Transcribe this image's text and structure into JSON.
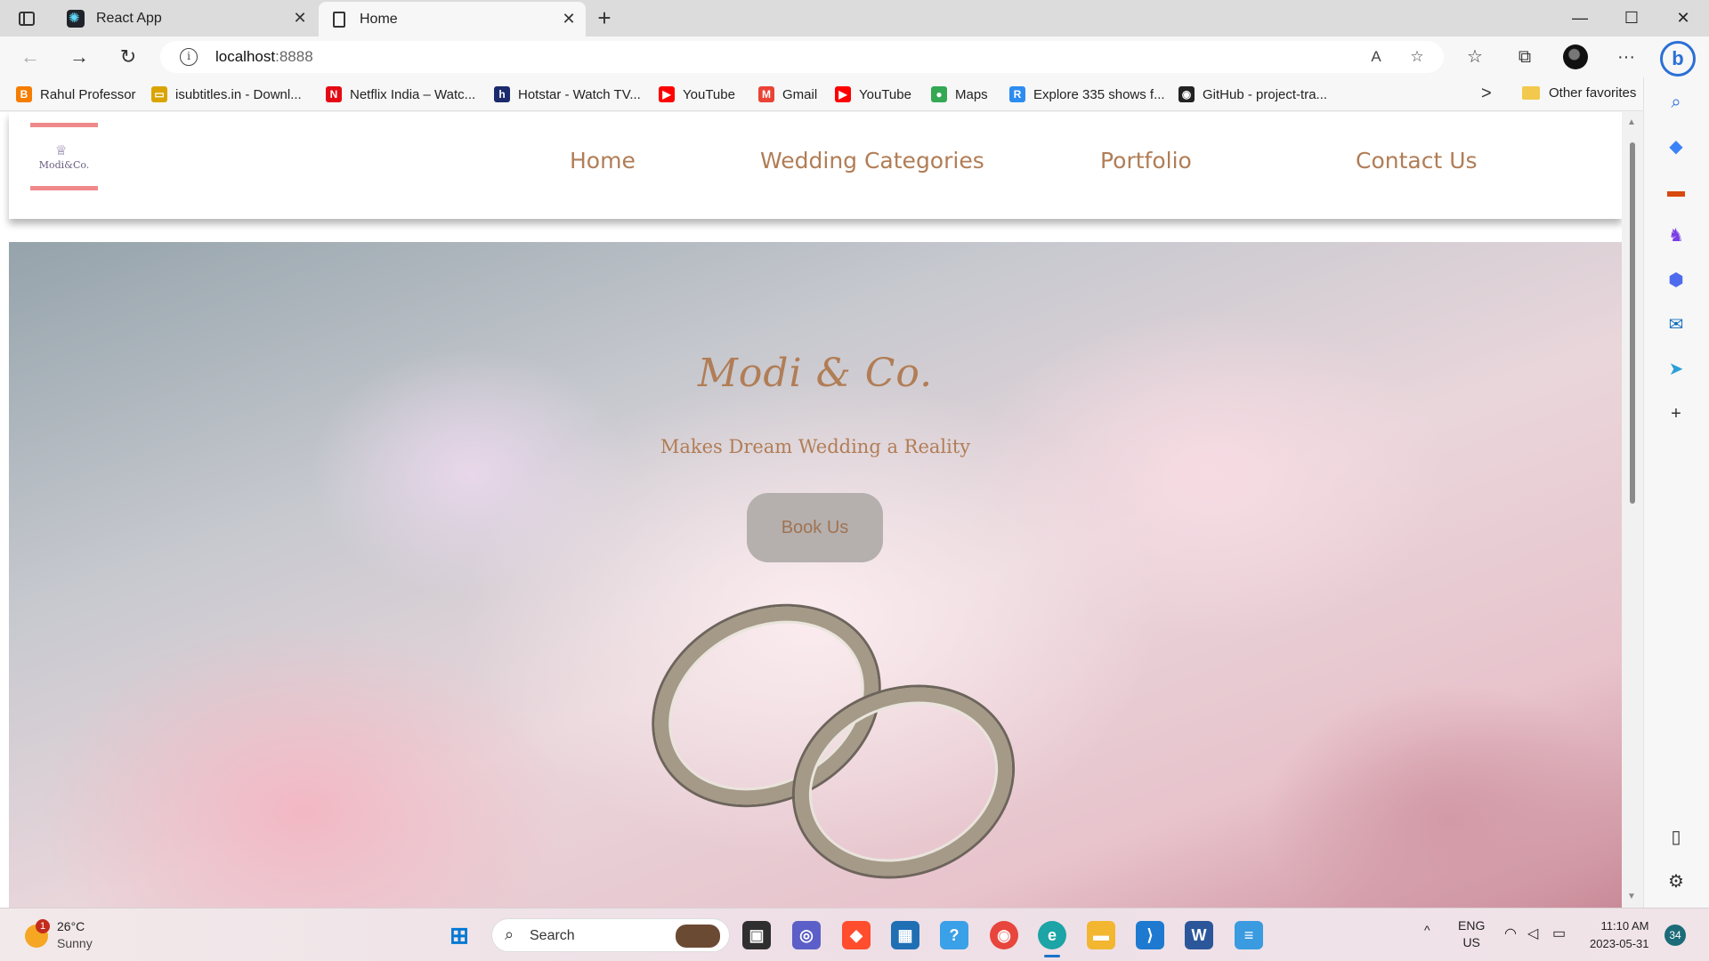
{
  "browser": {
    "tabs": [
      {
        "title": "React App",
        "close": "✕"
      },
      {
        "title": "Home",
        "close": "✕"
      }
    ],
    "new_tab": "+",
    "window_controls": {
      "minimize": "—",
      "maximize": "☐",
      "close": "✕"
    },
    "address": {
      "host": "localhost",
      "port": ":8888"
    },
    "icons": {
      "back": "←",
      "forward": "→",
      "reload": "↻",
      "info": "i",
      "read_aloud": "A",
      "add_favorite": "☆",
      "favorites": "☆",
      "collections": "⧉",
      "more": "···",
      "copilot": "b"
    }
  },
  "favorites": {
    "items": [
      {
        "label": "Rahul Professor",
        "icon": "blogger-icon",
        "color": "#f57d00",
        "glyph": "B"
      },
      {
        "label": "isubtitles.in - Downl...",
        "icon": "subtitle-icon",
        "color": "#d9a400",
        "glyph": "▭"
      },
      {
        "label": "Netflix India – Watc...",
        "icon": "netflix-icon",
        "color": "#e50914",
        "glyph": "N"
      },
      {
        "label": "Hotstar - Watch TV...",
        "icon": "hotstar-icon",
        "color": "#1a2a6c",
        "glyph": "h"
      },
      {
        "label": "YouTube",
        "icon": "youtube-icon",
        "color": "#ff0000",
        "glyph": "▶"
      },
      {
        "label": "Gmail",
        "icon": "gmail-icon",
        "color": "#ea4335",
        "glyph": "M"
      },
      {
        "label": "YouTube",
        "icon": "youtube-icon",
        "color": "#ff0000",
        "glyph": "▶"
      },
      {
        "label": "Maps",
        "icon": "maps-icon",
        "color": "#34a853",
        "glyph": "●"
      },
      {
        "label": "Explore 335 shows f...",
        "icon": "r-icon",
        "color": "#2d8cf0",
        "glyph": "R"
      },
      {
        "label": "GitHub - project-tra...",
        "icon": "github-icon",
        "color": "#222222",
        "glyph": "◉"
      }
    ],
    "overflow": ">",
    "other": "Other favorites"
  },
  "site": {
    "logo_text": "Modi&Co.",
    "logo_crown": "♕",
    "nav": [
      "Home",
      "Wedding Categories",
      "Portfolio",
      "Contact Us"
    ],
    "hero": {
      "title": "Modi & Co.",
      "subtitle": "Makes Dream Wedding a Reality",
      "cta": "Book Us"
    },
    "accent": "#b17d56"
  },
  "taskbar": {
    "weather": {
      "temp": "26°C",
      "condition": "Sunny",
      "alerts": "1"
    },
    "search_label": "Search",
    "search_icon": "⌕",
    "tray": {
      "chevron": "^",
      "lang": "ENG",
      "region": "US"
    },
    "clock": {
      "time": "11:10 AM",
      "date": "2023-05-31"
    },
    "notifications": "34"
  }
}
